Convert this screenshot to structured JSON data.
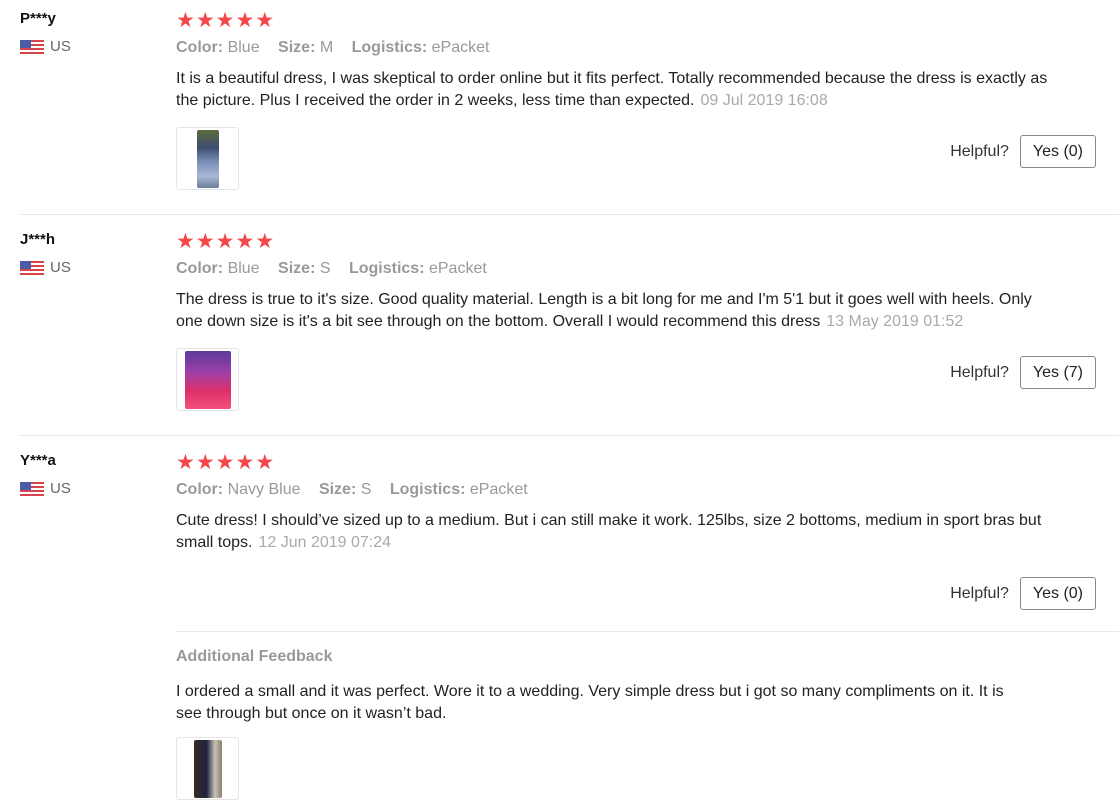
{
  "reviews": [
    {
      "user": "P***y",
      "country": "US",
      "rating": 5,
      "color_label": "Color:",
      "color": "Blue",
      "size_label": "Size:",
      "size": "M",
      "logistics_label": "Logistics:",
      "logistics": "ePacket",
      "text": "It is a beautiful dress, I was skeptical to order online but it fits perfect. Totally recommended because the dress is exactly as the picture. Plus I received the order in 2 weeks, less time than expected.",
      "date": "09 Jul 2019 16:08",
      "helpful_label": "Helpful?",
      "yes_label": "Yes (0)"
    },
    {
      "user": "J***h",
      "country": "US",
      "rating": 5,
      "color_label": "Color:",
      "color": "Blue",
      "size_label": "Size:",
      "size": "S",
      "logistics_label": "Logistics:",
      "logistics": "ePacket",
      "text": "The dress is true to it's size. Good quality material. Length is a bit long for me and I'm 5'1 but it goes well with heels. Only one down size is it's a bit see through on the bottom. Overall I would recommend this dress",
      "date": "13 May 2019 01:52",
      "helpful_label": "Helpful?",
      "yes_label": "Yes (7)"
    },
    {
      "user": "Y***a",
      "country": "US",
      "rating": 5,
      "color_label": "Color:",
      "color": "Navy Blue",
      "size_label": "Size:",
      "size": "S",
      "logistics_label": "Logistics:",
      "logistics": "ePacket",
      "text": "Cute dress! I should’ve sized up to a medium. But i can still make it work. 125lbs, size 2 bottoms, medium in sport bras but small tops.",
      "date": "12 Jun 2019 07:24",
      "helpful_label": "Helpful?",
      "yes_label": "Yes (0)",
      "additional_title": "Additional Feedback",
      "additional_text": "I ordered a small and it was perfect. Wore it to a wedding. Very simple dress but i got so many compliments on it. It is see through but once on it wasn’t bad."
    }
  ],
  "star_icon": "star-icon",
  "flag_icon": "us-flag-icon",
  "colors": {
    "star": "#f5474a",
    "muted": "#999999"
  }
}
